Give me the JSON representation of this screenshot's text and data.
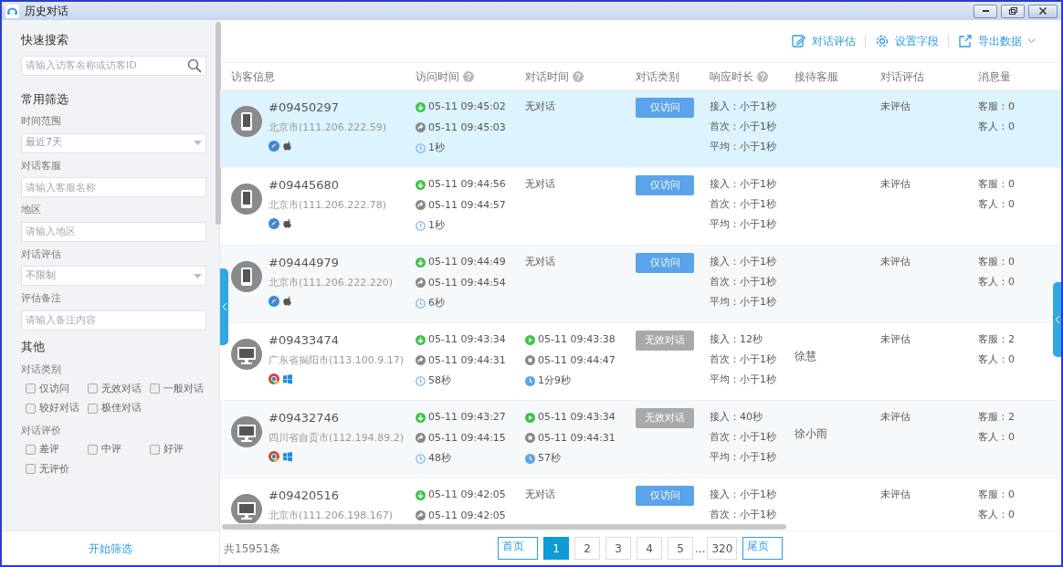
{
  "window": {
    "title": "历史对话"
  },
  "sidebar": {
    "search_title": "快速搜索",
    "search": {
      "placeholder": "请输入访客名称或访客ID"
    },
    "filters_title": "常用筛选",
    "filters": [
      {
        "kind": "select",
        "label": "时间范围",
        "value": "最近7天"
      },
      {
        "kind": "input",
        "label": "对话客服",
        "placeholder": "请输入客服名称"
      },
      {
        "kind": "input",
        "label": "地区",
        "placeholder": "请输入地区"
      },
      {
        "kind": "select",
        "label": "对话评估",
        "value": "不限制"
      },
      {
        "kind": "input",
        "label": "评估备注",
        "placeholder": "请输入备注内容"
      }
    ],
    "other_title": "其他",
    "groups": [
      {
        "label": "对话类别",
        "options": [
          {
            "label": "仅访问",
            "checked": false
          },
          {
            "label": "无效对话",
            "checked": false
          },
          {
            "label": "一般对话",
            "checked": false
          },
          {
            "label": "较好对话",
            "checked": false
          },
          {
            "label": "极佳对话",
            "checked": false
          }
        ]
      },
      {
        "label": "对话评价",
        "options": [
          {
            "label": "差评",
            "checked": false
          },
          {
            "label": "中评",
            "checked": false
          },
          {
            "label": "好评",
            "checked": false
          },
          {
            "label": "无评价",
            "checked": false
          }
        ]
      }
    ],
    "apply_button": "开始筛选"
  },
  "toolbar": [
    {
      "label": "对话评估",
      "dropdown": false
    },
    {
      "label": "设置字段",
      "dropdown": false
    },
    {
      "label": "导出数据",
      "dropdown": true
    }
  ],
  "table": {
    "columns": [
      {
        "label": "访客信息",
        "help": false
      },
      {
        "label": "访问时间",
        "help": true
      },
      {
        "label": "对话时间",
        "help": true
      },
      {
        "label": "对话类别",
        "help": false
      },
      {
        "label": "响应时长",
        "help": true
      },
      {
        "label": "接待客服",
        "help": false
      },
      {
        "label": "对话评估",
        "help": false
      },
      {
        "label": "消息量",
        "help": false
      }
    ],
    "rows": [
      {
        "selected": true,
        "avatar": {
          "kind": "mobile"
        },
        "platform_icons": [
          {
            "kind": "safari"
          },
          {
            "kind": "apple"
          }
        ],
        "id": "#09450297",
        "location": "北京市(111.206.222.59)",
        "visit": [
          "05-11 09:45:02",
          "05-11 09:45:03",
          "1秒"
        ],
        "chat": {
          "kind": "none",
          "text": "无对话"
        },
        "type": {
          "kind": "visit_only",
          "label": "仅访问"
        },
        "response": [
          "接入：小于1秒",
          "首次：小于1秒",
          "平均：小于1秒"
        ],
        "agent": "",
        "evaluation": "未评估",
        "messages": [
          "客服：0",
          "客人：0"
        ]
      },
      {
        "selected": false,
        "avatar": {
          "kind": "mobile"
        },
        "platform_icons": [
          {
            "kind": "safari"
          },
          {
            "kind": "apple"
          }
        ],
        "id": "#09445680",
        "location": "北京市(111.206.222.78)",
        "visit": [
          "05-11 09:44:56",
          "05-11 09:44:57",
          "1秒"
        ],
        "chat": {
          "kind": "none",
          "text": "无对话"
        },
        "type": {
          "kind": "visit_only",
          "label": "仅访问"
        },
        "response": [
          "接入：小于1秒",
          "首次：小于1秒",
          "平均：小于1秒"
        ],
        "agent": "",
        "evaluation": "未评估",
        "messages": [
          "客服：0",
          "客人：0"
        ]
      },
      {
        "selected": false,
        "avatar": {
          "kind": "mobile"
        },
        "platform_icons": [
          {
            "kind": "safari"
          },
          {
            "kind": "apple"
          }
        ],
        "id": "#09444979",
        "location": "北京市(111.206.222.220)",
        "visit": [
          "05-11 09:44:49",
          "05-11 09:44:54",
          "6秒"
        ],
        "chat": {
          "kind": "none",
          "text": "无对话"
        },
        "type": {
          "kind": "visit_only",
          "label": "仅访问"
        },
        "response": [
          "接入：小于1秒",
          "首次：小于1秒",
          "平均：小于1秒"
        ],
        "agent": "",
        "evaluation": "未评估",
        "messages": [
          "客服：0",
          "客人：0"
        ]
      },
      {
        "selected": false,
        "avatar": {
          "kind": "desktop"
        },
        "platform_icons": [
          {
            "kind": "chrome"
          },
          {
            "kind": "windows"
          }
        ],
        "id": "#09433474",
        "location": "广东省揭阳市(113.100.9.17)",
        "visit": [
          "05-11 09:43:34",
          "05-11 09:44:31",
          "58秒"
        ],
        "chat": {
          "kind": "times",
          "times": [
            "05-11 09:43:38",
            "05-11 09:44:47",
            "1分9秒"
          ]
        },
        "type": {
          "kind": "invalid",
          "label": "无效对话"
        },
        "response": [
          "接入：12秒",
          "首次：小于1秒",
          "平均：小于1秒"
        ],
        "agent": "徐慧",
        "evaluation": "未评估",
        "messages": [
          "客服：2",
          "客人：0"
        ]
      },
      {
        "selected": false,
        "avatar": {
          "kind": "desktop"
        },
        "platform_icons": [
          {
            "kind": "chrome"
          },
          {
            "kind": "windows"
          }
        ],
        "id": "#09432746",
        "location": "四川省自贡市(112.194.89.2)",
        "visit": [
          "05-11 09:43:27",
          "05-11 09:44:15",
          "48秒"
        ],
        "chat": {
          "kind": "times",
          "times": [
            "05-11 09:43:34",
            "05-11 09:44:31",
            "57秒"
          ]
        },
        "type": {
          "kind": "invalid",
          "label": "无效对话"
        },
        "response": [
          "接入：40秒",
          "首次：小于1秒",
          "平均：小于1秒"
        ],
        "agent": "徐小雨",
        "evaluation": "未评估",
        "messages": [
          "客服：2",
          "客人：0"
        ]
      },
      {
        "selected": false,
        "avatar": {
          "kind": "desktop"
        },
        "id": "#09420516",
        "location": "北京市(111.206.198.167)",
        "visit": [
          "05-11 09:42:05",
          "05-11 09:42:05"
        ],
        "chat": {
          "kind": "none",
          "text": "无对话"
        },
        "type": {
          "kind": "visit_only",
          "label": "仅访问"
        },
        "response": [
          "接入：小于1秒",
          "首次：小于1秒"
        ],
        "agent": "",
        "evaluation": "未评估",
        "messages": [
          "客服：0",
          "客人：0"
        ]
      }
    ]
  },
  "footer": {
    "total": "共15951条",
    "pages": [
      {
        "kind": "nav",
        "label": "首页",
        "selected": false
      },
      {
        "kind": "page",
        "label": "1",
        "selected": true
      },
      {
        "kind": "page",
        "label": "2",
        "selected": false
      },
      {
        "kind": "page",
        "label": "3",
        "selected": false
      },
      {
        "kind": "page",
        "label": "4",
        "selected": false
      },
      {
        "kind": "page",
        "label": "5",
        "selected": false
      },
      {
        "kind": "ellipsis",
        "label": "..."
      },
      {
        "kind": "page",
        "label": "320",
        "selected": false
      },
      {
        "kind": "nav",
        "label": "尾页",
        "selected": false
      }
    ]
  }
}
